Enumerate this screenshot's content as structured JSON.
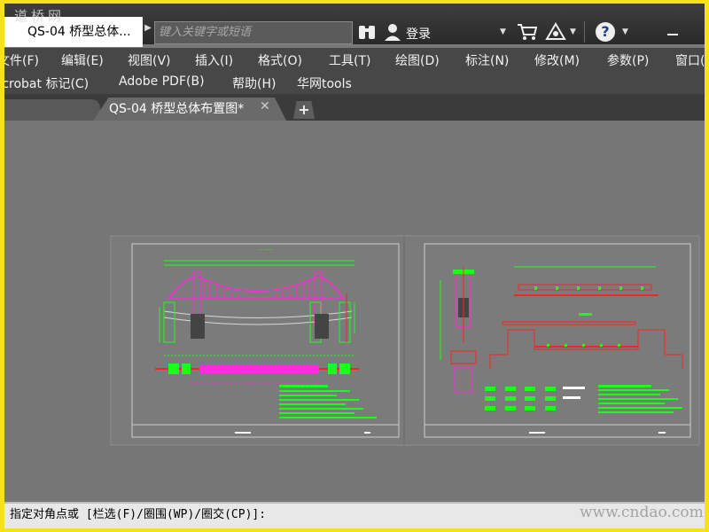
{
  "watermark": {
    "top": "道桥网",
    "bottom": "www.cndao.com"
  },
  "titlebar": {
    "doc_title": "QS-04 桥型总体...",
    "search_placeholder": "键入关键字或短语",
    "login": "登录",
    "help": "?"
  },
  "menu1": {
    "items": [
      "文件(F)",
      "编辑(E)",
      "视图(V)",
      "插入(I)",
      "格式(O)",
      "工具(T)",
      "绘图(D)",
      "标注(N)",
      "修改(M)",
      "参数(P)",
      "窗口("
    ]
  },
  "menu2": {
    "items": [
      "Acrobat 标记(C)",
      "Adobe PDF(B)",
      "帮助(H)",
      "华网tools"
    ]
  },
  "tabs": {
    "active": "QS-04 桥型总体布置图*",
    "close": "✕",
    "add": "+"
  },
  "cmdline": {
    "text": "指定对角点或 [栏选(F)/圈围(WP)/圈交(CP)]:"
  },
  "colors": {
    "drawing_green": "#1aff1a",
    "drawing_magenta": "#ff2bd6",
    "drawing_red": "#ff2020",
    "drawing_white": "#ffffff",
    "bg_canvas": "#777777"
  }
}
